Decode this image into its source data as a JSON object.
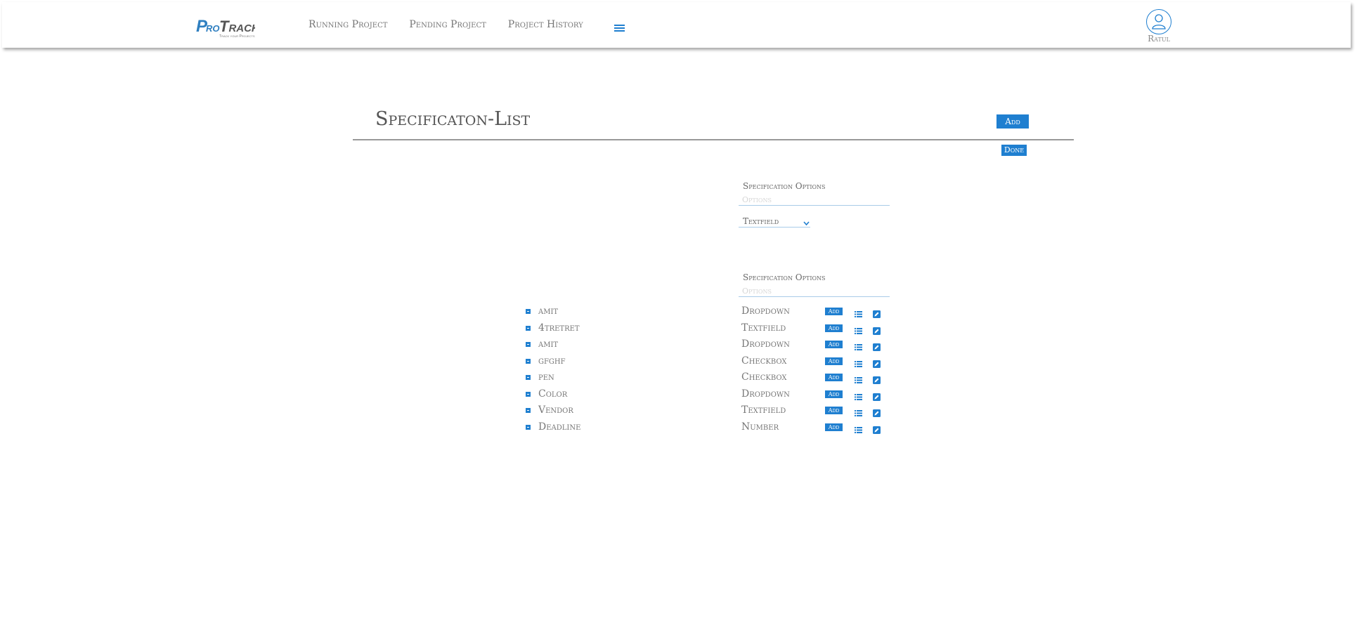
{
  "header": {
    "logo_text": "ProTrack",
    "logo_tagline": "Track your Projects",
    "nav": [
      "Running Project",
      "Pending Project",
      "Project History"
    ],
    "user_name": "Ratul"
  },
  "page": {
    "title": "Specificaton-List",
    "add_label": "Add",
    "done_label": "Done"
  },
  "options_block_1": {
    "label": "Specification Options",
    "placeholder": "Options",
    "type_selected": "Textfield"
  },
  "options_block_2": {
    "label": "Specification Options",
    "placeholder": "Options"
  },
  "spec_items": [
    {
      "name": "amit",
      "type": "Dropdown",
      "add_label": "Add"
    },
    {
      "name": "4tretret",
      "type": "Textfield",
      "add_label": "Add"
    },
    {
      "name": "amit",
      "type": "Dropdown",
      "add_label": "Add"
    },
    {
      "name": "gfghf",
      "type": "Checkbox",
      "add_label": "Add"
    },
    {
      "name": "pen",
      "type": "Checkbox",
      "add_label": "Add"
    },
    {
      "name": "Color",
      "type": "Dropdown",
      "add_label": "Add"
    },
    {
      "name": "Vendor",
      "type": "Textfield",
      "add_label": "Add"
    },
    {
      "name": "Deadline",
      "type": "Number",
      "add_label": "Add"
    }
  ],
  "colors": {
    "accent": "#1f7fd0",
    "text": "#777777",
    "rule": "#999999"
  }
}
